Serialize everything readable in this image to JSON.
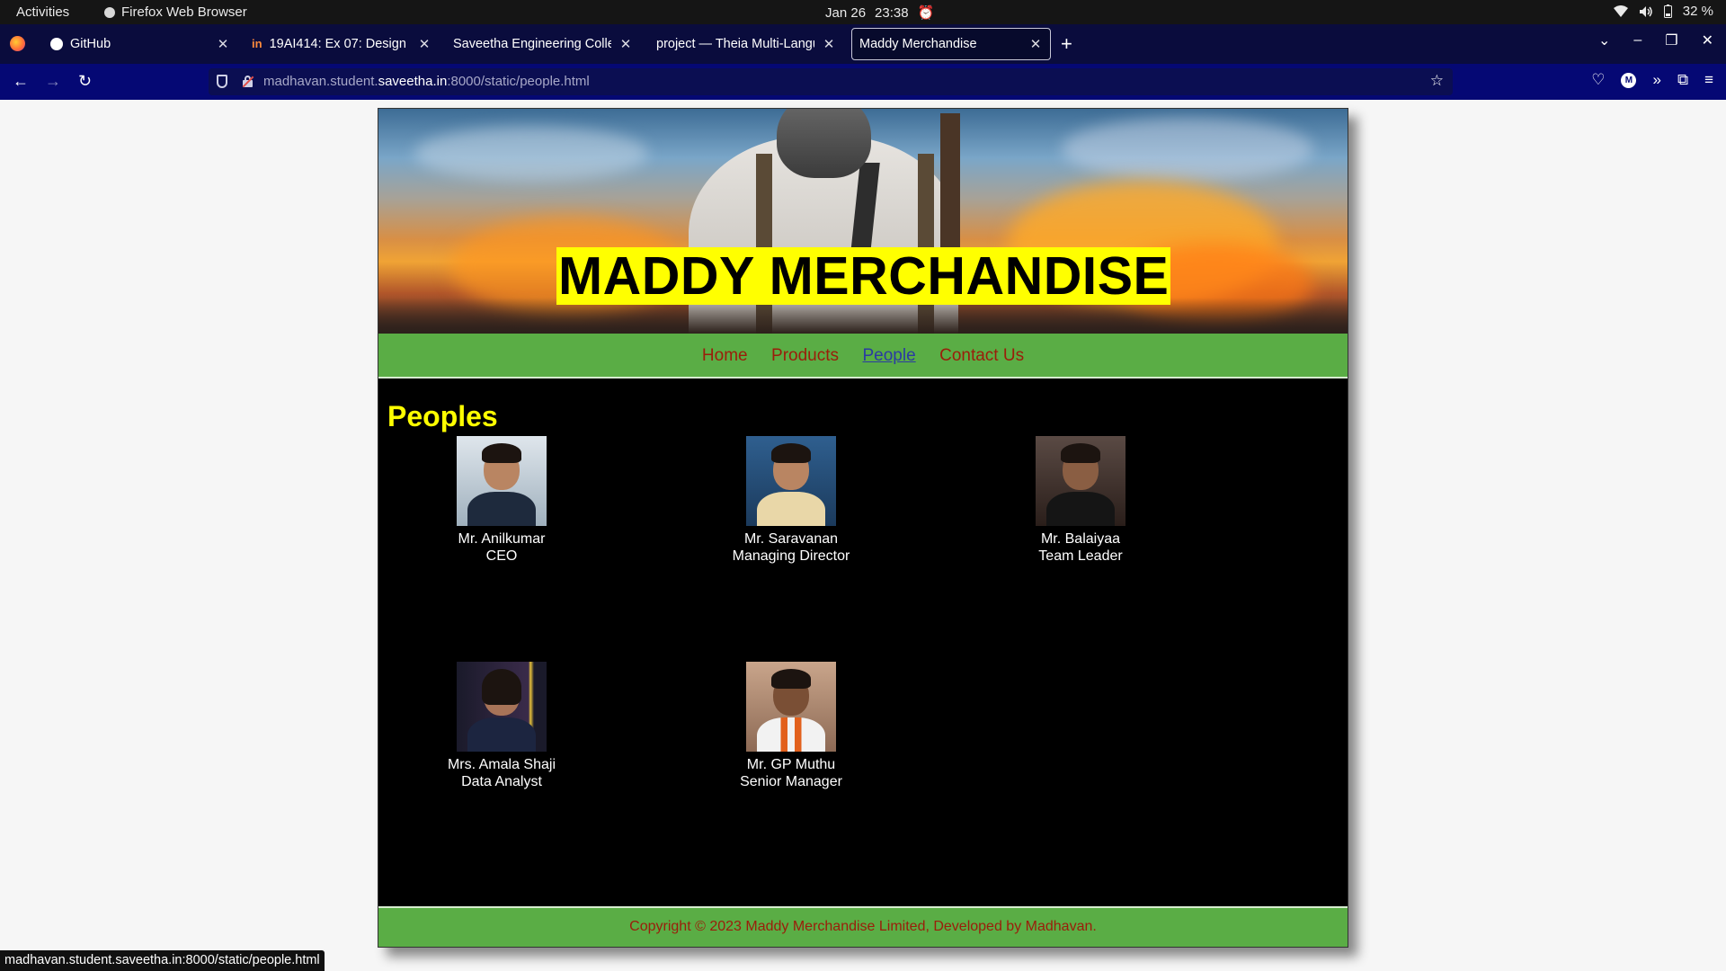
{
  "system": {
    "activities": "Activities",
    "app_name": "Firefox Web Browser",
    "date": "Jan 26",
    "time": "23:38",
    "battery": "32 %",
    "icons": [
      "alarm-icon",
      "wifi-icon",
      "volume-icon",
      "battery-icon"
    ]
  },
  "tabs": [
    {
      "title": "GitHub",
      "icon": "github-icon"
    },
    {
      "title": "19AI414: Ex 07: Design a",
      "icon": "in-icon"
    },
    {
      "title": "Saveetha Engineering Colleg",
      "icon": ""
    },
    {
      "title": "project — Theia Multi-Langu",
      "icon": ""
    },
    {
      "title": "Maddy Merchandise",
      "icon": "",
      "active": true
    }
  ],
  "url": {
    "prefix": "madhavan.student.",
    "host": "saveetha.in",
    "suffix": ":8000/static/people.html"
  },
  "site": {
    "title": "MADDY MERCHANDISE",
    "menu": [
      "Home",
      "Products",
      "People",
      "Contact Us"
    ],
    "current_menu": "People",
    "heading": "Peoples",
    "people": [
      {
        "name": "Mr. Anilkumar",
        "role": "CEO"
      },
      {
        "name": "Mr. Saravanan",
        "role": "Managing Director"
      },
      {
        "name": "Mr. Balaiyaa",
        "role": "Team Leader"
      },
      {
        "name": "Mrs. Amala Shaji",
        "role": "Data Analyst"
      },
      {
        "name": "Mr. GP Muthu",
        "role": "Senior Manager"
      }
    ],
    "footer": "Copyright © 2023 Maddy Merchandise Limited, Developed by Madhavan.",
    "colors": {
      "accent_yellow": "#ffff00",
      "menu_green": "#5aad45",
      "link_red": "#9b1d0a",
      "link_active": "#2b3aa3"
    }
  },
  "status_url": "madhavan.student.saveetha.in:8000/static/people.html"
}
